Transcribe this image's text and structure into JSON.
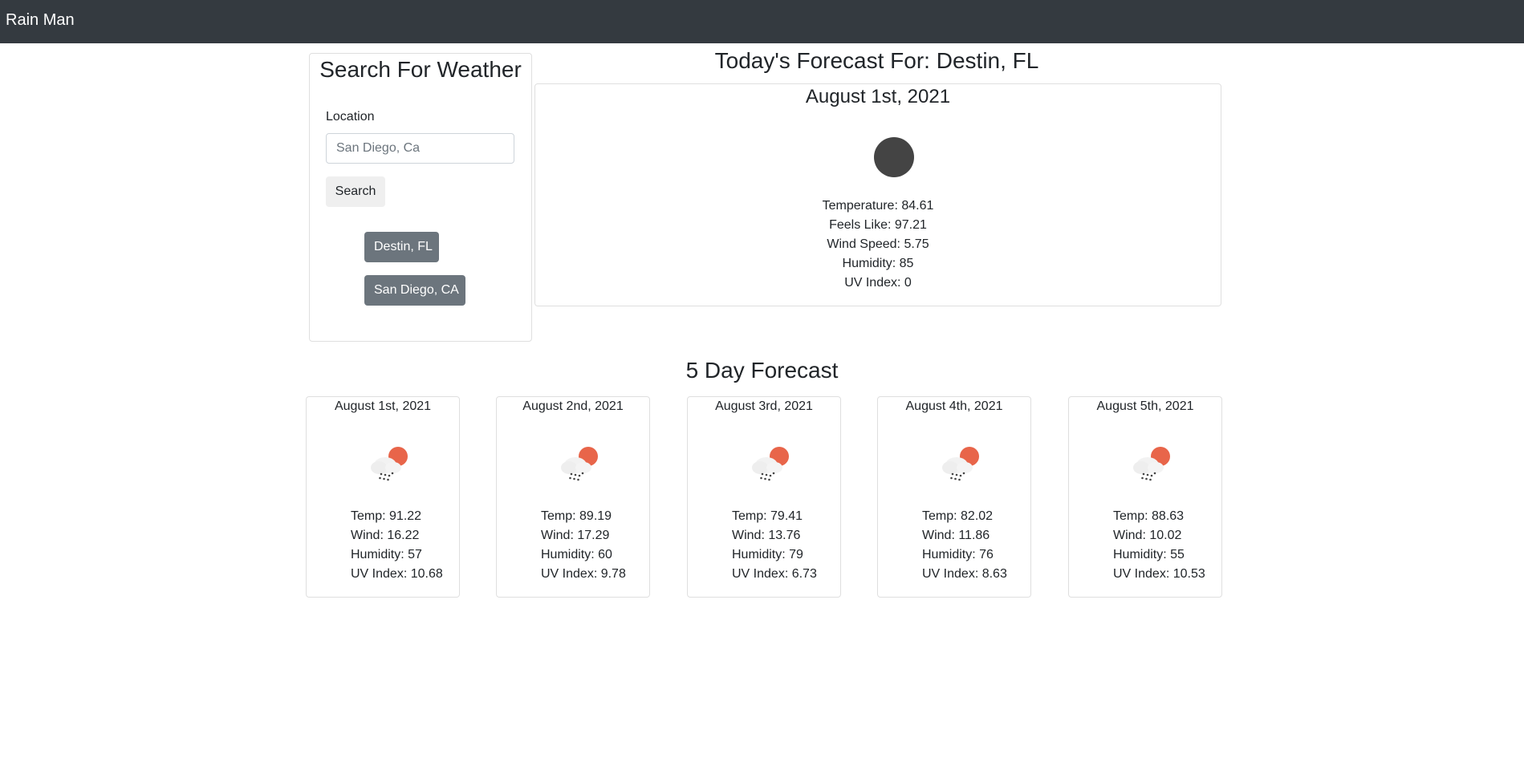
{
  "navbar": {
    "brand": "Rain Man"
  },
  "search": {
    "title": "Search For Weather",
    "location_label": "Location",
    "input_value": "",
    "input_placeholder": "San Diego, Ca",
    "button_label": "Search",
    "history": [
      "Destin, FL",
      "San Diego, CA"
    ]
  },
  "today": {
    "heading": "Today's Forecast For: Destin, FL",
    "date": "August 1st, 2021",
    "icon": "weather-icon",
    "temperature": "Temperature: 84.61",
    "feels_like": "Feels Like: 97.21",
    "wind_speed": "Wind Speed: 5.75",
    "humidity": "Humidity: 85",
    "uv_index": "UV Index: 0"
  },
  "five_day": {
    "heading": "5 Day Forecast",
    "icon": "cloud-rain-sun-icon",
    "days": [
      {
        "date": "August 1st, 2021",
        "temp": "Temp: 91.22",
        "wind": "Wind: 16.22",
        "humidity": "Humidity: 57",
        "uv": "UV Index: 10.68"
      },
      {
        "date": "August 2nd, 2021",
        "temp": "Temp: 89.19",
        "wind": "Wind: 17.29",
        "humidity": "Humidity: 60",
        "uv": "UV Index: 9.78"
      },
      {
        "date": "August 3rd, 2021",
        "temp": "Temp: 79.41",
        "wind": "Wind: 13.76",
        "humidity": "Humidity: 79",
        "uv": "UV Index: 6.73"
      },
      {
        "date": "August 4th, 2021",
        "temp": "Temp: 82.02",
        "wind": "Wind: 11.86",
        "humidity": "Humidity: 76",
        "uv": "UV Index: 8.63"
      },
      {
        "date": "August 5th, 2021",
        "temp": "Temp: 88.63",
        "wind": "Wind: 10.02",
        "humidity": "Humidity: 55",
        "uv": "UV Index: 10.53"
      }
    ]
  },
  "colors": {
    "navbar": "#343a40",
    "history_button": "#6c757d",
    "sun": "#e8654a"
  }
}
